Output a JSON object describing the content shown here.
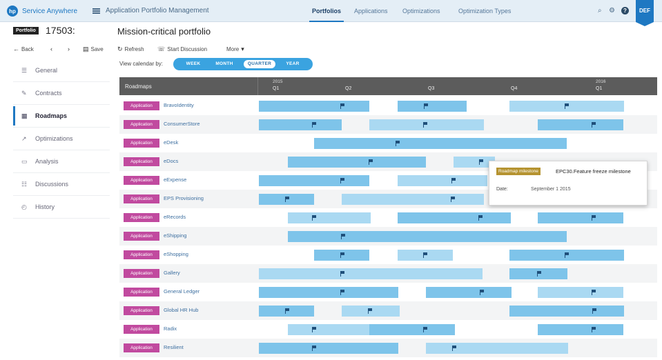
{
  "topbar": {
    "brand": "Service Anywhere",
    "app_title": "Application Portfolio Management",
    "nav": [
      "Portfolios",
      "Applications",
      "Optimizations",
      "Optimization Types"
    ],
    "active_nav": "Portfolios",
    "user_initials": "DEF",
    "icons": [
      "search-icon",
      "settings-icon",
      "help-icon"
    ]
  },
  "header": {
    "badge": "Portfolio",
    "id": "17503:",
    "title": "Mission-critical portfolio"
  },
  "toolbar": {
    "back": "Back",
    "save": "Save",
    "refresh": "Refresh",
    "start_discussion": "Start Discussion",
    "more": "More"
  },
  "sidebar": {
    "items": [
      {
        "label": "General",
        "icon": "list-icon"
      },
      {
        "label": "Contracts",
        "icon": "contract-icon"
      },
      {
        "label": "Roadmaps",
        "icon": "roadmap-icon",
        "active": true
      },
      {
        "label": "Optimizations",
        "icon": "optimize-icon"
      },
      {
        "label": "Analysis",
        "icon": "calendar-icon"
      },
      {
        "label": "Discussions",
        "icon": "discussion-icon"
      },
      {
        "label": "History",
        "icon": "history-icon"
      }
    ]
  },
  "calendar": {
    "label": "View calendar by:",
    "options": [
      "WEEK",
      "MONTH",
      "QUARTER",
      "YEAR"
    ],
    "selected": "QUARTER"
  },
  "roadmap": {
    "header_label": "Roadmaps",
    "years": [
      "2015",
      "2016"
    ],
    "quarters": [
      "Q1",
      "Q2",
      "Q3",
      "Q4",
      "Q1"
    ],
    "badge_label": "Application",
    "rows": [
      "BravoIdentity",
      "ConsumerStore",
      "eDesk",
      "eDocs",
      "eExpense",
      "EPS Provisioning",
      "eRecords",
      "eShipping",
      "eShopping",
      "Gallery",
      "General Ledger",
      "Global HR Hub",
      "Radix",
      "Resilient"
    ]
  },
  "tooltip": {
    "badge": "Roadmap milestone",
    "title": "EPC30.Feature freeze milestone",
    "date_label": "Date:",
    "date_value": "September 1 2015"
  },
  "colors": {
    "accent": "#1e78c2",
    "app_badge": "#c14a9f",
    "bar_dark": "#7ec4ea",
    "bar_light": "#aad9f2",
    "milestone": "#b59330",
    "grid_header": "#5c5c5c"
  }
}
